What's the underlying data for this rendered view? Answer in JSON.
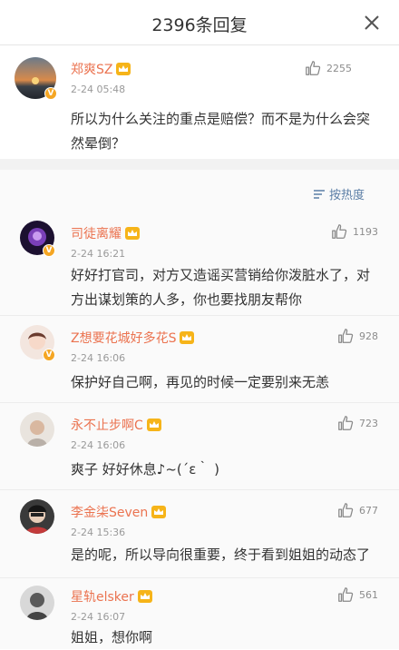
{
  "header": {
    "title": "2396条回复"
  },
  "main": {
    "username": "郑爽SZ",
    "time": "2-24 05:48",
    "likes": "2255",
    "text": "所以为什么关注的重点是赔偿？而不是为什么会突然晕倒？"
  },
  "sort": {
    "label": "按热度"
  },
  "replies": [
    {
      "username": "司徒离耀",
      "time": "2-24 16:21",
      "likes": "1193",
      "text": "好好打官司，对方又造谣买营销给你泼脏水了，对方出谋划策的人多，你也要找朋友帮你"
    },
    {
      "username": "Z想要花城好多花S",
      "time": "2-24 16:06",
      "likes": "928",
      "text": "保护好自己啊，再见的时候一定要别来无恙"
    },
    {
      "username": "永不止步啊C",
      "time": "2-24 16:06",
      "likes": "723",
      "text": "爽子 好好休息♪~(´ε｀ )"
    },
    {
      "username": "李金柒Seven",
      "time": "2-24 15:36",
      "likes": "677",
      "text": "是的呢，所以导向很重要，终于看到姐姐的动态了"
    },
    {
      "username": "星轨elsker",
      "time": "2-24 16:07",
      "likes": "561",
      "text": "姐姐，想你啊"
    }
  ],
  "colors": {
    "username": "#eb7350",
    "link": "#5b7ea6",
    "badge": "#f5a623"
  }
}
